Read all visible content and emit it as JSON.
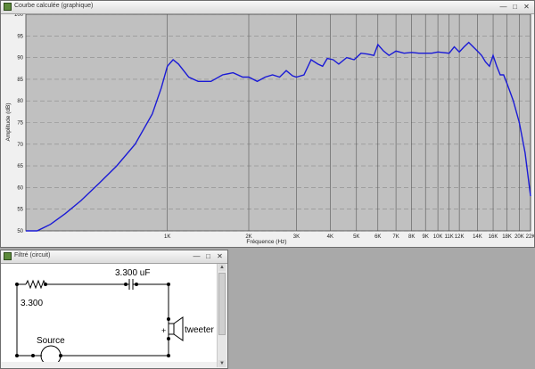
{
  "chart_window": {
    "title": "Courbe calculée (graphique)",
    "controls": {
      "minimize": "—",
      "maximize": "□",
      "close": "✕"
    }
  },
  "circuit_window": {
    "title": "Filtré (circuit)",
    "controls": {
      "minimize": "—",
      "maximize": "□",
      "close": "✕"
    },
    "labels": {
      "resistor_value": "3.300",
      "capacitor_value": "3.300 uF",
      "source": "Source",
      "tweeter": "tweeter",
      "plus": "+"
    }
  },
  "chart_data": {
    "type": "line",
    "xlabel": "Fréquence (Hz)",
    "ylabel": "Amplitude (dB)",
    "xscale": "log",
    "xlim": [
      300,
      22000
    ],
    "ylim": [
      50,
      100
    ],
    "yticks": [
      50,
      55,
      60,
      65,
      70,
      75,
      80,
      85,
      90,
      95,
      100
    ],
    "xticks": [
      {
        "v": 1000,
        "label": "1K"
      },
      {
        "v": 2000,
        "label": "2K"
      },
      {
        "v": 3000,
        "label": "3K"
      },
      {
        "v": 4000,
        "label": "4K"
      },
      {
        "v": 5000,
        "label": "5K"
      },
      {
        "v": 6000,
        "label": "6K"
      },
      {
        "v": 7000,
        "label": "7K"
      },
      {
        "v": 8000,
        "label": "8K"
      },
      {
        "v": 9000,
        "label": "9K"
      },
      {
        "v": 10000,
        "label": "10K"
      },
      {
        "v": 11000,
        "label": "11K"
      },
      {
        "v": 12000,
        "label": "12K"
      },
      {
        "v": 14000,
        "label": "14K"
      },
      {
        "v": 16000,
        "label": "16K"
      },
      {
        "v": 18000,
        "label": "18K"
      },
      {
        "v": 20000,
        "label": "20K"
      },
      {
        "v": 22000,
        "label": "22K"
      }
    ],
    "grid": true,
    "line_color": "#1a1ad6",
    "series": [
      {
        "x": [
          300,
          330,
          370,
          420,
          480,
          560,
          650,
          760,
          880,
          950,
          1000,
          1050,
          1100,
          1200,
          1300,
          1450,
          1600,
          1750,
          1900,
          2000,
          2150,
          2300,
          2450,
          2600,
          2750,
          2900,
          3000,
          3200,
          3400,
          3600,
          3750,
          3900,
          4100,
          4300,
          4600,
          4900,
          5200,
          5500,
          5800,
          6000,
          6300,
          6600,
          7000,
          7500,
          8000,
          8500,
          9000,
          9500,
          10000,
          11000,
          11500,
          12000,
          12500,
          13000,
          13500,
          14000,
          14500,
          15000,
          15500,
          16000,
          16500,
          17000,
          17500,
          18000,
          18500,
          19000,
          20000,
          21000,
          22000
        ],
        "y": [
          50,
          50,
          51.5,
          54,
          57,
          61,
          65,
          70,
          77,
          83,
          88,
          89.5,
          88.5,
          85.5,
          84.5,
          84.5,
          86,
          86.5,
          85.5,
          85.5,
          84.5,
          85.5,
          86,
          85.5,
          87,
          85.8,
          85.5,
          86,
          89.5,
          88.5,
          88,
          89.8,
          89.5,
          88.5,
          90,
          89.5,
          91,
          90.8,
          90.5,
          93,
          91.5,
          90.5,
          91.5,
          91,
          91.2,
          91,
          91,
          91,
          91.3,
          91,
          92.5,
          91.3,
          92.5,
          93.5,
          92.5,
          91.5,
          90.5,
          89,
          88,
          90.5,
          88,
          86,
          86,
          84,
          82,
          80,
          75,
          68,
          58
        ]
      }
    ]
  }
}
